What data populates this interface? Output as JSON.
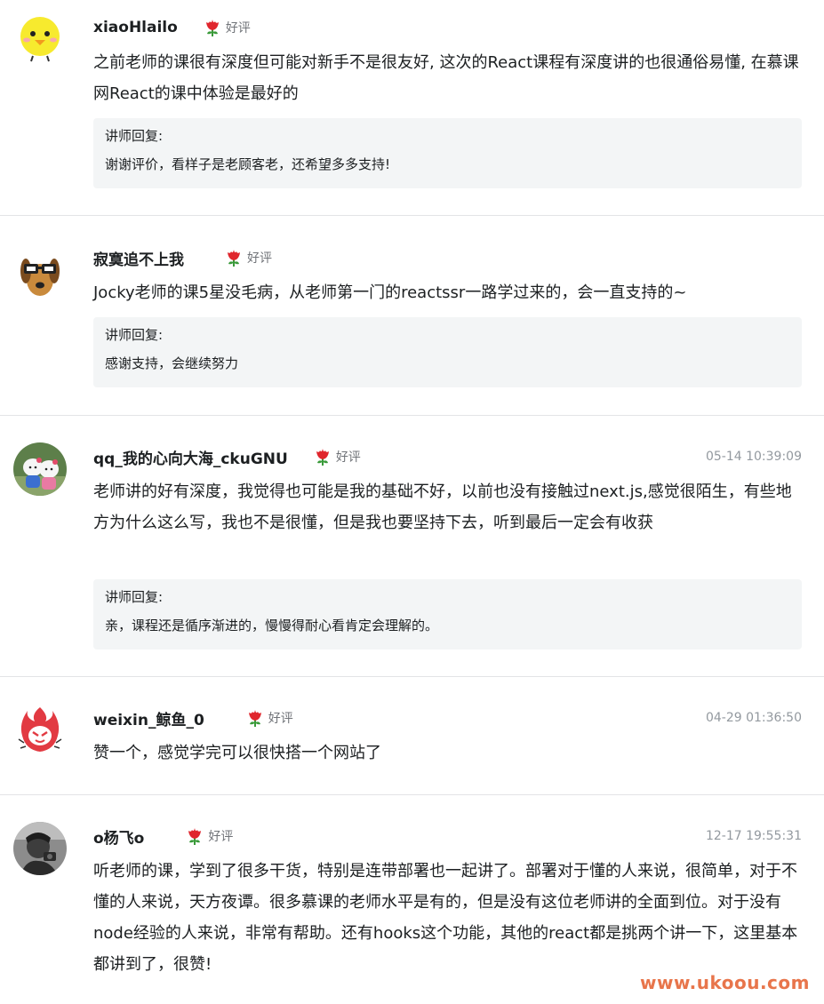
{
  "reviews": [
    {
      "username": "xiaoHlailo",
      "rating_icon": "flower-icon",
      "rating": "好评",
      "time": "",
      "content": "之前老师的课很有深度但可能对新手不是很友好, 这次的React课程有深度讲的也很通俗易懂, 在慕课网React的课中体验是最好的",
      "reply_title": "讲师回复:",
      "reply": "谢谢评价，看样子是老顾客老，还希望多多支持!"
    },
    {
      "username": "寂寞追不上我",
      "rating_icon": "flower-icon",
      "rating": "好评",
      "time": "",
      "content": "Jocky老师的课5星没毛病，从老师第一门的reactssr一路学过来的，会一直支持的~",
      "reply_title": "讲师回复:",
      "reply": "感谢支持，会继续努力"
    },
    {
      "username": "qq_我的心向大海_ckuGNU",
      "rating_icon": "flower-icon",
      "rating": "好评",
      "time": "05-14 10:39:09",
      "content": "老师讲的好有深度，我觉得也可能是我的基础不好，以前也没有接触过next.js,感觉很陌生，有些地方为什么这么写，我也不是很懂，但是我也要坚持下去，听到最后一定会有收获",
      "reply_title": "讲师回复:",
      "reply": "亲，课程还是循序渐进的，慢慢得耐心看肯定会理解的。"
    },
    {
      "username": "weixin_鲸鱼_0",
      "rating_icon": "flower-icon",
      "rating": "好评",
      "time": "04-29 01:36:50",
      "content": "赞一个，感觉学完可以很快搭一个网站了"
    },
    {
      "username": "o杨飞o",
      "rating_icon": "flower-icon",
      "rating": "好评",
      "time": "12-17 19:55:31",
      "content": "听老师的课，学到了很多干货，特别是连带部署也一起讲了。部署对于懂的人来说，很简单，对于不懂的人来说，天方夜谭。很多慕课的老师水平是有的，但是没有这位老师讲的全面到位。对于没有node经验的人来说，非常有帮助。还有hooks这个功能，其他的react都是挑两个讲一下，这里基本都讲到了，很赞!"
    }
  ],
  "watermark": "www.ukoou.com",
  "colors": {
    "text": "#1c1f21",
    "muted": "#93999f",
    "reply_bg": "#f3f5f6",
    "divider": "#e3e4e6",
    "watermark": "#e8754b",
    "flower": "#e0262d"
  }
}
